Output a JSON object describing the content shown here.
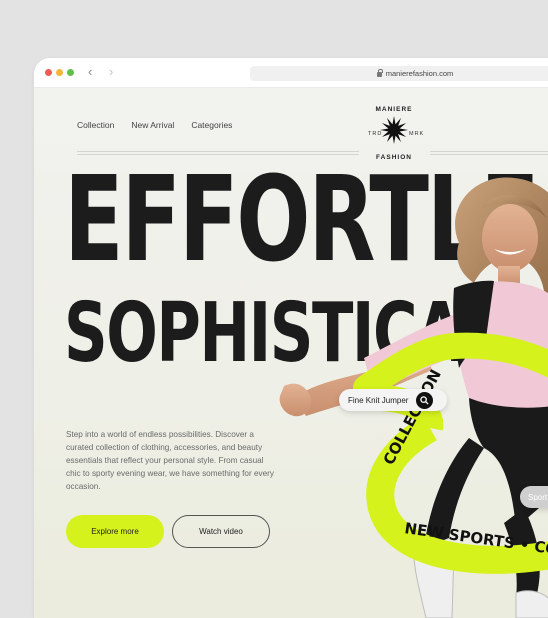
{
  "browser": {
    "url": "manierefashion.com"
  },
  "nav": {
    "items": [
      "Collection",
      "New Arrival",
      "Categories"
    ]
  },
  "logo": {
    "top": "MANIERE",
    "bottom": "FASHION",
    "left": "TRD",
    "right": "MRK"
  },
  "hero": {
    "line1": "EFFORTLE",
    "line2": "SOPHISTICA",
    "description": "Step into a world of endless possibilities. Discover a curated collection of clothing, accessories, and beauty essentials that reflect your personal style. From casual chic to sporty evening wear, we have something for every occasion.",
    "primary_button": "Explore more",
    "secondary_button": "Watch video"
  },
  "ribbon": {
    "text_a": "COLLECTION",
    "text_b": "SPO",
    "text_c": "NEW SPORTS • COLLECTION"
  },
  "product_chip": {
    "label": "Fine Knit Jumper"
  },
  "side_chip": {
    "label": "Sport"
  },
  "colors": {
    "accent": "#d5f21d",
    "text_dark": "#1c1c1c"
  }
}
